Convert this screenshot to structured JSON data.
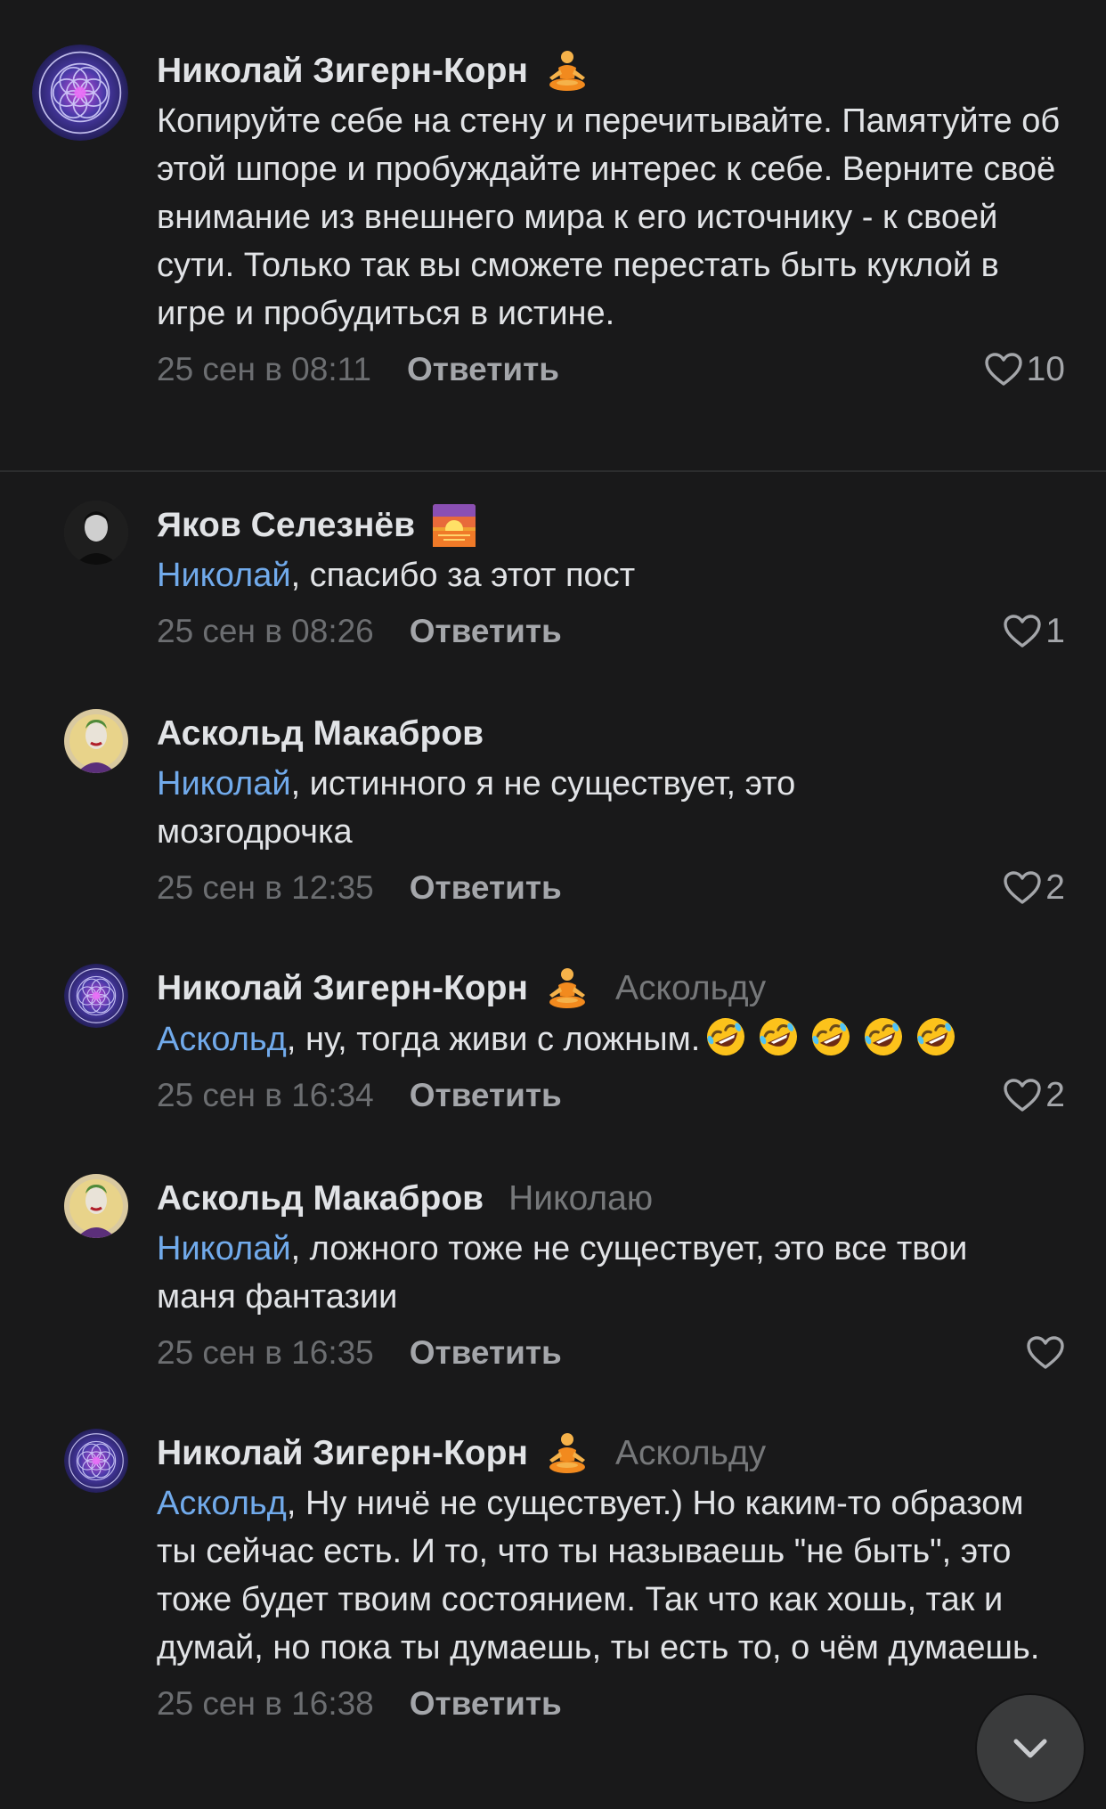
{
  "comments": [
    {
      "author": "Николай Зигерн-Корн",
      "author_emoji": "person-in-lotus-position-emoji",
      "reply_to": "",
      "mention": "",
      "text": "Копируйте себе на стену и перечитывайте. Памятуйте об этой шпоре и пробуждайте интерес к себе. Верните своё внимание из внешнего мира к его источнику - к своей сути. Только так вы сможете перестать быть куклой в игре и пробудиться в истине.",
      "date": "25 сен в 08:11",
      "reply_label": "Ответить",
      "likes": "10"
    },
    {
      "author": "Яков Селезнёв",
      "author_emoji": "sunrise-emoji",
      "reply_to": "",
      "mention": "Николай",
      "text": ", спасибо за этот пост",
      "date": "25 сен в 08:26",
      "reply_label": "Ответить",
      "likes": "1"
    },
    {
      "author": "Аскольд Макабров",
      "author_emoji": "",
      "reply_to": "",
      "mention": "Николай",
      "text": ", истинного я не существует, это мозгодрочка",
      "date": "25 сен в 12:35",
      "reply_label": "Ответить",
      "likes": "2"
    },
    {
      "author": "Николай Зигерн-Корн",
      "author_emoji": "person-in-lotus-position-emoji",
      "reply_to": "Аскольду",
      "mention": "Аскольд",
      "text": ", ну, тогда живи с ложным.",
      "trailing_emoji": [
        "rolling-on-floor-laughing-emoji",
        "rolling-on-floor-laughing-emoji",
        "rolling-on-floor-laughing-emoji",
        "rolling-on-floor-laughing-emoji",
        "rolling-on-floor-laughing-emoji"
      ],
      "date": "25 сен в 16:34",
      "reply_label": "Ответить",
      "likes": "2"
    },
    {
      "author": "Аскольд Макабров",
      "author_emoji": "",
      "reply_to": "Николаю",
      "mention": "Николай",
      "text": ", ложного тоже не существует, это все твои маня фантазии",
      "date": "25 сен в 16:35",
      "reply_label": "Ответить",
      "likes": ""
    },
    {
      "author": "Николай Зигерн-Корн",
      "author_emoji": "person-in-lotus-position-emoji",
      "reply_to": "Аскольду",
      "mention": "Аскольд",
      "text": ", Ну ничё не существует.) Но каким-то образом ты сейчас есть. И то, что ты называешь \"не быть\", это тоже будет твоим состоянием. Так что как хошь, так и думай, но пока ты думаешь, ты есть то, о чём думаешь.",
      "date": "25 сен в 16:38",
      "reply_label": "Ответить",
      "likes": ""
    }
  ],
  "icons": {
    "like": "heart-outline-icon",
    "scroll_down": "chevron-down-icon"
  },
  "colors": {
    "background": "#19191a",
    "mention": "#71aaeb",
    "secondary_text": "#6c6e71"
  }
}
